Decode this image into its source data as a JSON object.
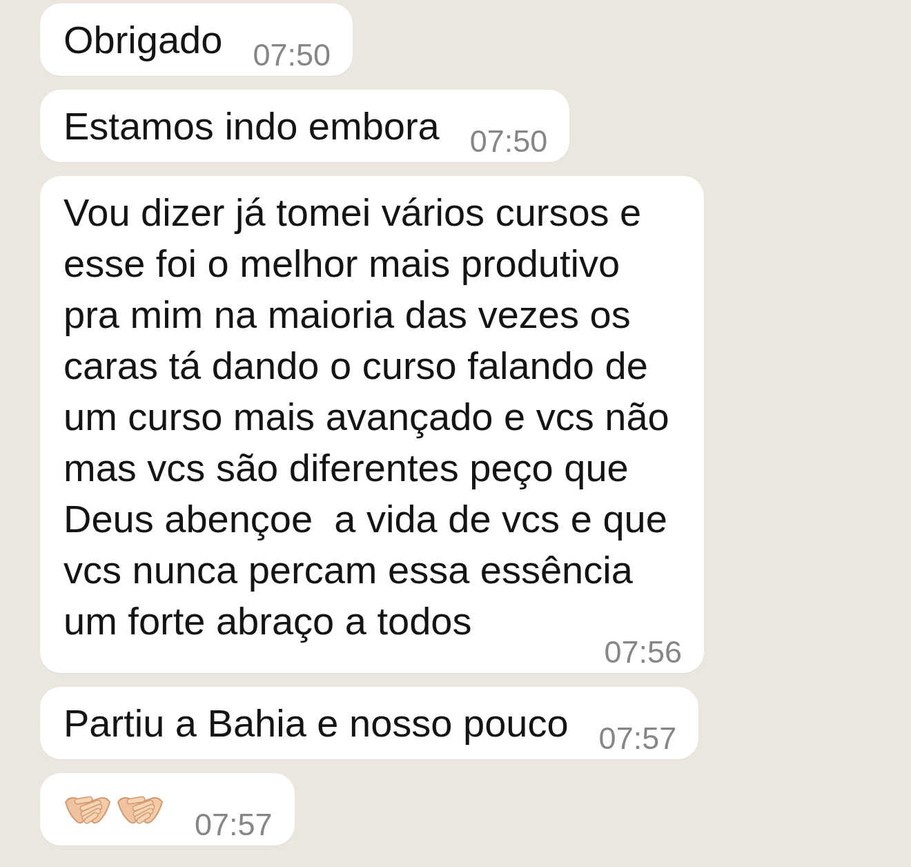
{
  "messages": [
    {
      "kind": "text",
      "text": "Obrigado",
      "time": "07:50"
    },
    {
      "kind": "text",
      "text": "Estamos indo embora",
      "time": "07:50"
    },
    {
      "kind": "text",
      "text": "Vou dizer já tomei vários cursos e esse foi o melhor mais produtivo pra mim na maioria das vezes os caras tá dando o curso falando de um curso mais avançado e vcs não mas vcs são diferentes peço que Deus abençoe  a vida de vcs e que vcs nunca percam essa essência um forte abraço a todos",
      "time": "07:56"
    },
    {
      "kind": "text",
      "text": "Partiu a Bahia e nosso pouco",
      "time": "07:57"
    },
    {
      "kind": "emoji",
      "time": "07:57"
    }
  ]
}
